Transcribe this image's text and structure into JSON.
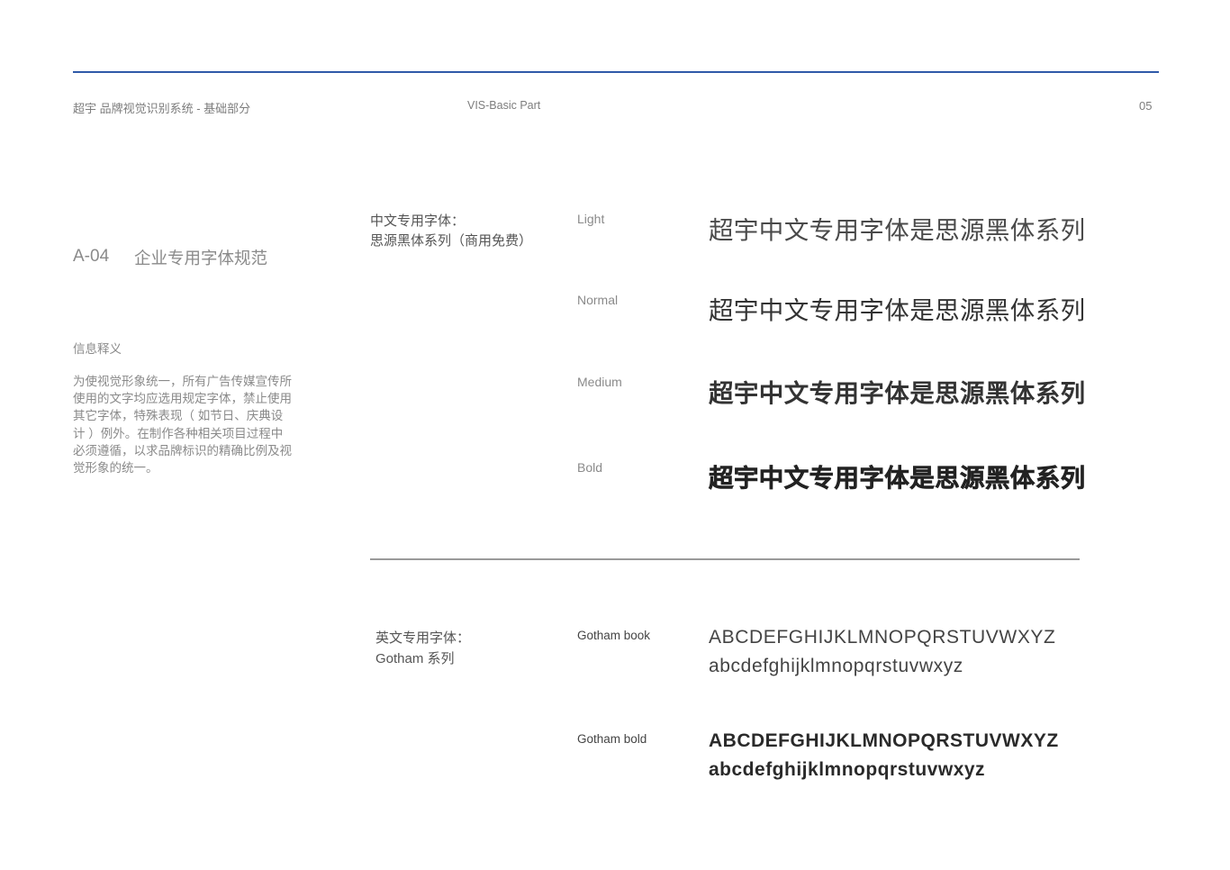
{
  "header": {
    "title": "超宇 品牌视觉识别系统 - 基础部分",
    "subtitle": "VIS-Basic Part",
    "page_number": "05",
    "rule_color": "#2f5aa8"
  },
  "section": {
    "code": "A-04",
    "name": "企业专用字体规范"
  },
  "info": {
    "heading": "信息释义",
    "body": "为使视觉形象统一，所有广告传媒宣传所使用的文字均应选用规定字体，禁止使用其它字体，特殊表现（ 如节日、庆典设计 ）例外。在制作各种相关项目过程中必须遵循，以求品牌标识的精确比例及视觉形象的统一。"
  },
  "chinese_font": {
    "label_line1": "中文专用字体：",
    "label_line2": "思源黑体系列（商用免费）",
    "weights": [
      {
        "name": "Light",
        "sample": "超宇中文专用字体是思源黑体系列"
      },
      {
        "name": "Normal",
        "sample": "超宇中文专用字体是思源黑体系列"
      },
      {
        "name": "Medium",
        "sample": "超宇中文专用字体是思源黑体系列"
      },
      {
        "name": "Bold",
        "sample": "超宇中文专用字体是思源黑体系列"
      }
    ]
  },
  "english_font": {
    "label_line1": "英文专用字体：",
    "label_line2": "Gotham 系列",
    "fonts": [
      {
        "name": "Gotham book",
        "upper": "ABCDEFGHIJKLMNOPQRSTUVWXYZ",
        "lower": "abcdefghijklmnopqrstuvwxyz"
      },
      {
        "name": "Gotham bold",
        "upper": "ABCDEFGHIJKLMNOPQRSTUVWXYZ",
        "lower": "abcdefghijklmnopqrstuvwxyz"
      }
    ]
  }
}
